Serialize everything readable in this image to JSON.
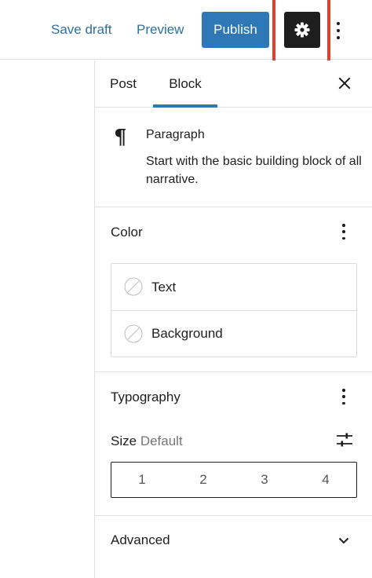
{
  "topbar": {
    "save_draft": "Save draft",
    "preview": "Preview",
    "publish": "Publish",
    "settings_icon": "gear-icon",
    "more_icon": "vertical-ellipsis-icon",
    "accent": "#2f78b7",
    "highlight_color": "#e2402e"
  },
  "sidebar": {
    "tabs": [
      {
        "label": "Post",
        "active": false
      },
      {
        "label": "Block",
        "active": true
      }
    ],
    "close_icon": "close-icon",
    "block_card": {
      "icon": "pilcrow-icon",
      "glyph": "¶",
      "title": "Paragraph",
      "description": "Start with the basic building block of all narrative."
    },
    "color_panel": {
      "title": "Color",
      "items": [
        {
          "label": "Text",
          "icon": "no-color-swatch-icon"
        },
        {
          "label": "Background",
          "icon": "no-color-swatch-icon"
        }
      ]
    },
    "typography_panel": {
      "title": "Typography",
      "size_label": "Size",
      "size_value": "Default",
      "size_options": [
        "1",
        "2",
        "3",
        "4"
      ],
      "custom_size_icon": "sliders-icon"
    },
    "advanced_panel": {
      "title": "Advanced",
      "icon": "chevron-down-icon"
    }
  }
}
